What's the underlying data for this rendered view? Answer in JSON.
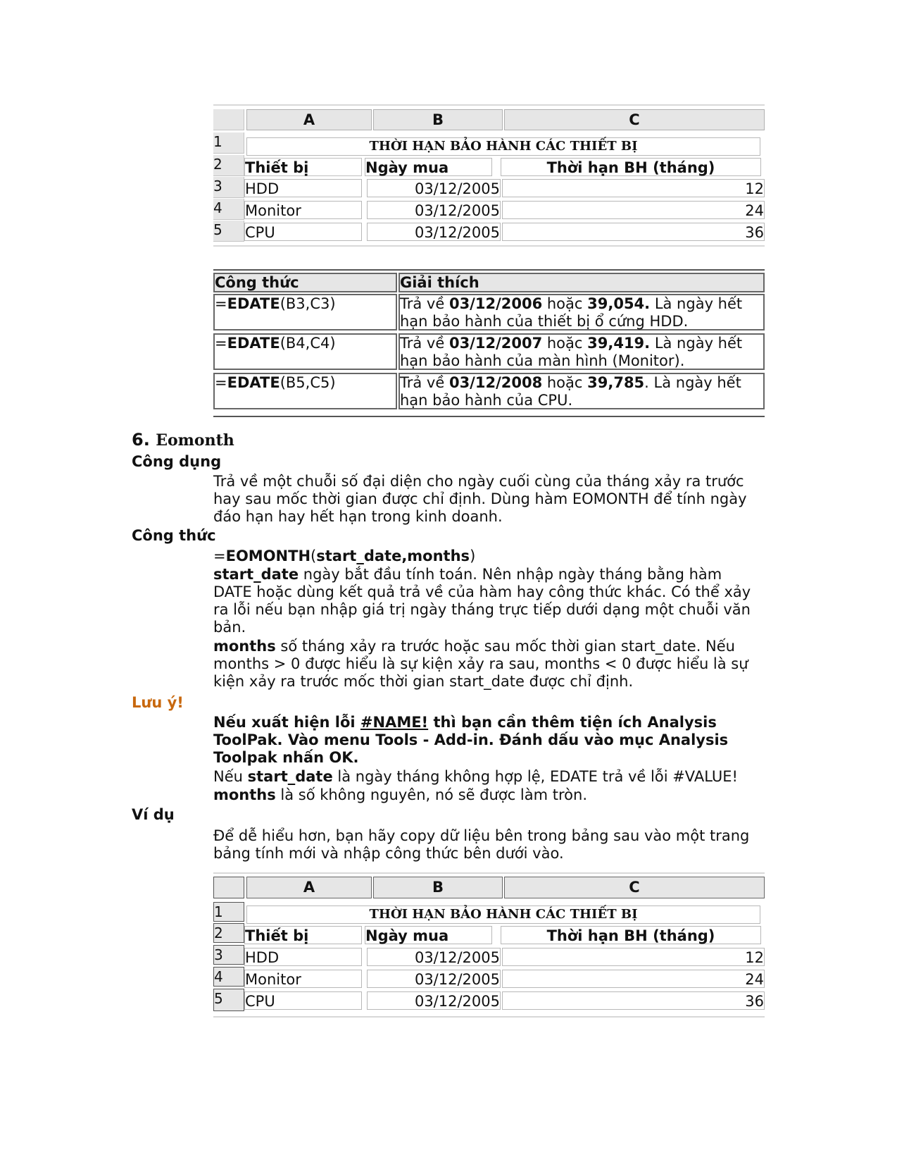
{
  "table1": {
    "col_headers": [
      "A",
      "B",
      "C"
    ],
    "title": "THỜI HẠN BẢO HÀNH CÁC THIẾT BỊ",
    "headers": [
      "Thiết bị",
      "Ngày mua",
      "Thời hạn BH (tháng)"
    ],
    "rows": [
      {
        "num": "3",
        "device": "HDD",
        "date": "03/12/2005",
        "months": "12"
      },
      {
        "num": "4",
        "device": "Monitor",
        "date": "03/12/2005",
        "months": "24"
      },
      {
        "num": "5",
        "device": "CPU",
        "date": "03/12/2005",
        "months": "36"
      }
    ],
    "row_nums": [
      "1",
      "2"
    ]
  },
  "formula_table": {
    "headers": [
      "Công thức",
      "Giải thích"
    ],
    "rows": [
      {
        "fn": "=EDATE",
        "fn_eq": "=",
        "fn_name": "EDATE",
        "args": "(B3,C3)",
        "p1": "Trả về ",
        "date": "03/12/2006",
        "p2": " hoặc ",
        "serial": "39,054.",
        "p3": " Là ngày hết hạn bảo hành của thiết bị ổ cứng HDD."
      },
      {
        "fn": "=EDATE",
        "fn_eq": "=",
        "fn_name": "EDATE",
        "args": "(B4,C4)",
        "p1": "Trả về ",
        "date": "03/12/2007",
        "p2": " hoặc ",
        "serial": "39,419.",
        "p3": " Là ngày hết hạn bảo hành của màn hình (Monitor)."
      },
      {
        "fn": "=EDATE",
        "fn_eq": "=",
        "fn_name": "EDATE",
        "args": "(B5,C5)",
        "p1": "Trả về ",
        "date": "03/12/2008",
        "p2": " hoặc ",
        "serial": "39,785",
        "p3": ". Là ngày hết hạn bảo hành của CPU."
      }
    ]
  },
  "section": {
    "number": "6.",
    "title": "Eomonth",
    "usage_label": "Công dụng",
    "usage_text": "Trả về một chuỗi số đại diện cho ngày cuối cùng của tháng xảy ra trước hay sau mốc thời gian được chỉ định. Dùng hàm EOMONTH để tính ngày đáo hạn hay hết hạn trong kinh doanh.",
    "formula_label": "Công thức",
    "syntax_eq": "=",
    "syntax_fn": "EOMONTH",
    "syntax_open": "(",
    "syntax_args": "start_date,months",
    "syntax_close": ")",
    "arg1_name": "start_date",
    "arg1_text": " ngày bắt đầu tính toán. Nên nhập ngày tháng bằng hàm DATE hoặc dùng kết quả trả về của hàm hay công thức khác. Có thể xảy ra lỗi nếu bạn nhập giá trị ngày tháng trực tiếp dưới dạng một chuỗi văn bản.",
    "arg2_name": "months",
    "arg2_text": " số tháng xảy ra trước hoặc sau mốc thời gian start_date. Nếu months > 0 được hiểu là sự kiện xảy ra sau, months < 0 được hiểu là sự kiện xảy ra trước mốc thời gian start_date được chỉ định.",
    "note_label": "Lưu ý!",
    "note_bold_1": "Nếu xuất hiện lỗi ",
    "note_link": "#NAME!",
    "note_bold_2": " thì bạn cần thêm tiện ích Analysis ToolPak. Vào menu Tools - Add-in. Đánh dấu vào mục Analysis Toolpak nhấn OK.",
    "note2_pre": "Nếu ",
    "note2_bold": "start_date",
    "note2_post": " là ngày tháng không hợp lệ, EDATE trả về lỗi #VALUE!",
    "note3_bold": "months",
    "note3_post": " là số không nguyên, nó sẽ được làm tròn.",
    "example_label": "Ví dụ",
    "example_text": "Để dễ hiểu hơn, bạn hãy copy dữ liệu bên trong bảng sau vào một trang bảng tính mới và nhập công thức bên dưới vào."
  },
  "colors": {
    "note": "#c8680e",
    "header_bg": "#e6e6e6"
  }
}
